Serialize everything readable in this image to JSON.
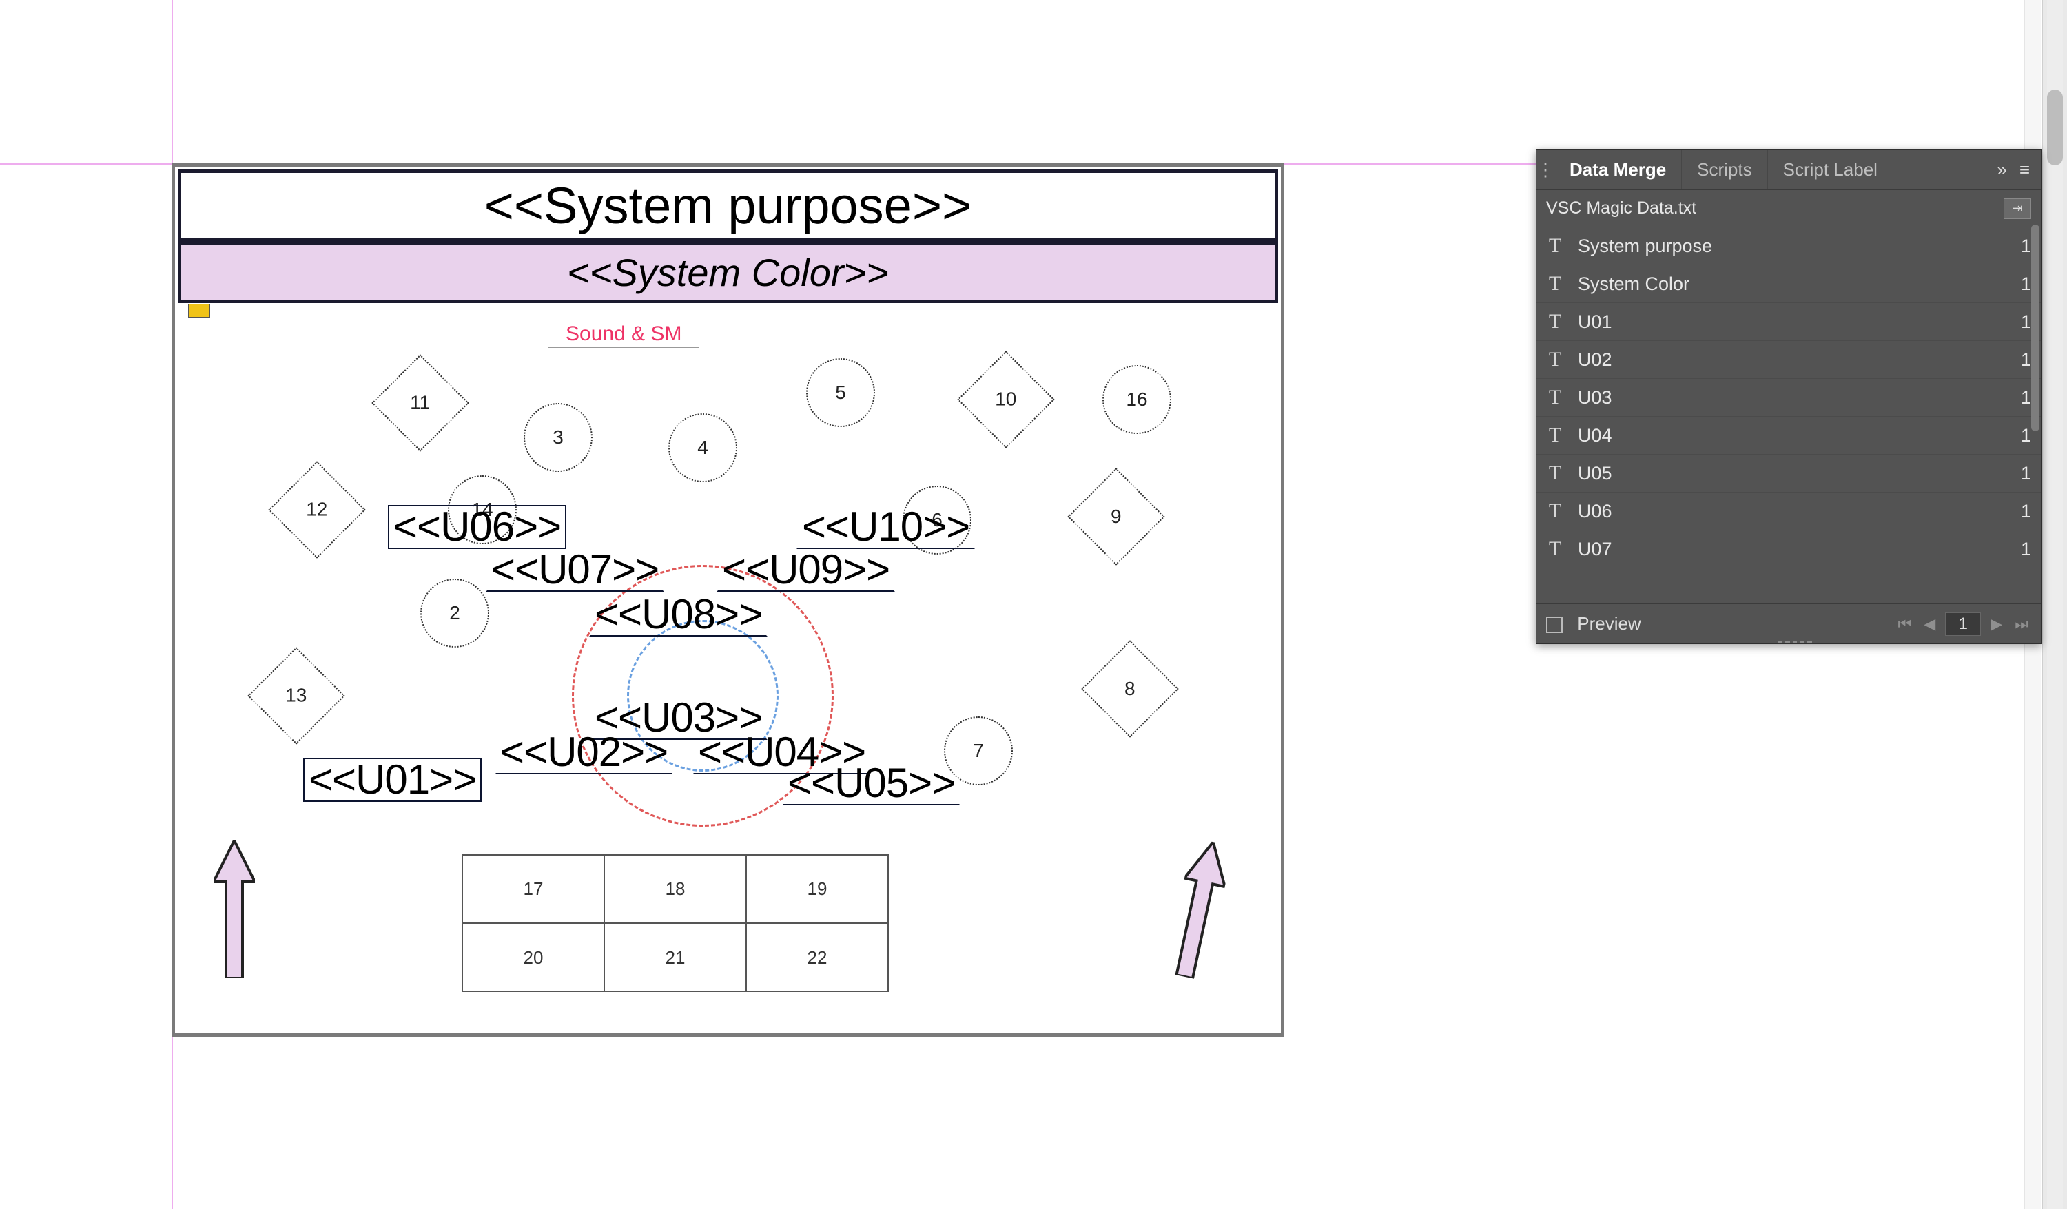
{
  "canvas": {
    "title_placeholder": "<<System purpose>>",
    "subtitle_placeholder": "<<System Color>>",
    "sound_label": "Sound & SM",
    "tables": {
      "t2": "2",
      "t3": "3",
      "t4": "4",
      "t5": "5",
      "t6": "6",
      "t7": "7",
      "t8": "8",
      "t9": "9",
      "t10": "10",
      "t11": "11",
      "t12": "12",
      "t13": "13",
      "t14": "14",
      "t16": "16",
      "b17": "17",
      "b18": "18",
      "b19": "19",
      "b20": "20",
      "b21": "21",
      "b22": "22"
    },
    "frames": {
      "u01": "<<U01>>",
      "u02": "<<U02>>",
      "u03": "<<U03>>",
      "u04": "<<U04>>",
      "u05": "<<U05>>",
      "u06": "<<U06>>",
      "u07": "<<U07>>",
      "u08": "<<U08>>",
      "u09": "<<U09>>",
      "u10": "<<U10>>"
    }
  },
  "panel": {
    "tabs": {
      "data_merge": "Data Merge",
      "scripts": "Scripts",
      "script_label": "Script Label"
    },
    "source_file": "VSC Magic Data.txt",
    "t_glyph": "T",
    "fields": [
      {
        "name": "System purpose",
        "count": "1"
      },
      {
        "name": "System Color",
        "count": "1"
      },
      {
        "name": "U01",
        "count": "1"
      },
      {
        "name": "U02",
        "count": "1"
      },
      {
        "name": "U03",
        "count": "1"
      },
      {
        "name": "U04",
        "count": "1"
      },
      {
        "name": "U05",
        "count": "1"
      },
      {
        "name": "U06",
        "count": "1"
      },
      {
        "name": "U07",
        "count": "1"
      }
    ],
    "preview_label": "Preview",
    "page_number": "1",
    "icons": {
      "collapse": "»",
      "menu": "≡",
      "first": "⏮",
      "prev": "◀",
      "next": "▶",
      "last": "⏭",
      "opts": "⋮",
      "src_btn": "⇥"
    }
  }
}
